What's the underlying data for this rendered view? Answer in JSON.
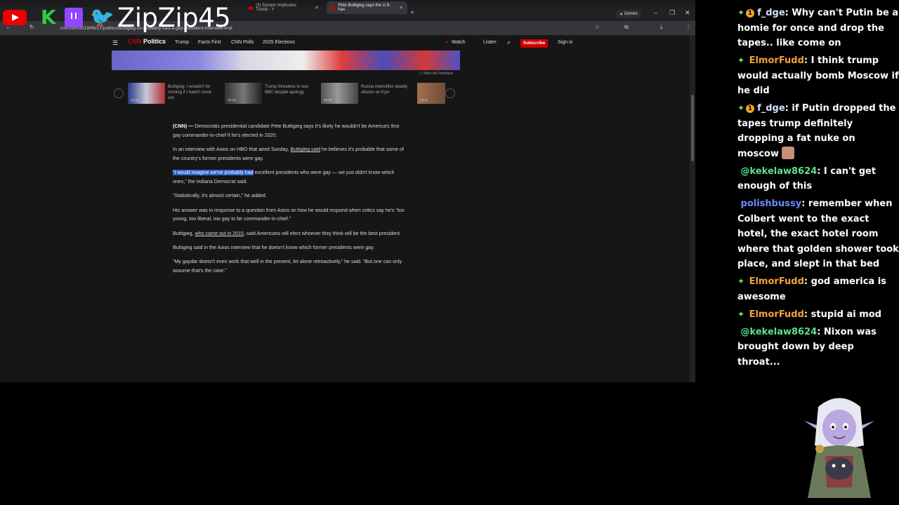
{
  "browser": {
    "tabs": [
      {
        "label": "(3) Epstein Implicates Trump - Y",
        "active": false
      },
      {
        "label": "Pete Buttigieg says the U.S. has",
        "active": true
      }
    ],
    "gemini_label": "Gemini",
    "url": "cnn.com/2019/06/17/politics/buttigieg-us-probably-had-a-gay-president-interview-trnd"
  },
  "cnn": {
    "logo_cnn": "CNN",
    "logo_section": "Politics",
    "nav": [
      "Trump",
      "Facts First",
      "CNN Polls",
      "2025 Elections"
    ],
    "watch": "Watch",
    "listen": "Listen",
    "subscribe": "Subscribe",
    "signin": "Sign in",
    "video_feedback": "Video Ad Feedback"
  },
  "carousel": [
    {
      "caption": "Buttigieg: I wouldn't be running if I hadn't come out",
      "duration": "01:00"
    },
    {
      "caption": "Trump threatens to sue BBC despite apology",
      "duration": "00:29"
    },
    {
      "caption": "Russia intensifies deadly attacks on Kyiv",
      "duration": "00:58"
    },
    {
      "caption": "",
      "duration": "02:21"
    }
  ],
  "article": {
    "p1_lead": "(CNN) —",
    "p1_rest": " Democratic presidential candidate Pete Buttigieg says it's likely he wouldn't be America's first gay commander-in-chief if he's elected in 2020.",
    "p2_a": "In an interview with Axios on HBO that aired Sunday, ",
    "p2_link": "Buttigieg said",
    "p2_b": " he believes it's probable that some of the country's former presidents were gay.",
    "p3_highlight": "“I would imagine we've probably had",
    "p3_rest": " excellent presidents who were gay — we just didn't know which ones,” the Indiana Democrat said.",
    "p4": "“Statistically, it's almost certain,” he added.",
    "p5": "His answer was in response to a question from Axios on how he would respond when critics say he's “too young, too liberal, too gay to be commander-in-chief.”",
    "p6_a": "Buttigieg, ",
    "p6_link": "who came out in 2015",
    "p6_b": ", said Americans will elect whoever they think will be the best president.",
    "p7": "Buttigieg said in the Axios interview that he doesn't know which former presidents were gay.",
    "p8": "“My gaydar doesn't even work that well in the present, let alone retroactively,” he said. “But one can only assume that's the case.”"
  },
  "overlay": {
    "streamer": "ZipZip45",
    "icons": [
      "youtube-icon",
      "kick-icon",
      "twitch-icon",
      "twitter-icon"
    ]
  },
  "chat": [
    {
      "user": "f_dge",
      "color": "#d6e0ff",
      "badge": true,
      "text": ": Why can't Putin be a homie for once and drop the tapes.. like come on"
    },
    {
      "user": "ElmorFudd",
      "color": "#f0a33a",
      "badge": false,
      "text": ": I think trump would actually bomb Moscow if he did"
    },
    {
      "user": "f_dge",
      "color": "#d6e0ff",
      "badge": true,
      "text": ": if Putin dropped the tapes trump definitely dropping a fat nuke on moscow"
    },
    {
      "user": "@kekelaw8624",
      "color": "#5fe08a",
      "badge": false,
      "text": ": I can't get enough of this"
    },
    {
      "user": "polishbussy",
      "color": "#6b8bff",
      "badge": false,
      "text": ": remember when Colbert went to the exact hotel, the exact hotel room where that golden shower took place, and slept in that bed"
    },
    {
      "user": "ElmorFudd",
      "color": "#f0a33a",
      "badge": false,
      "text": ": god america is awesome"
    },
    {
      "user": "ElmorFudd",
      "color": "#f0a33a",
      "badge": false,
      "text": ": stupid ai mod"
    },
    {
      "user": "@kekelaw8624",
      "color": "#5fe08a",
      "badge": false,
      "text": ": Nixon was brought down by deep throat..."
    }
  ]
}
